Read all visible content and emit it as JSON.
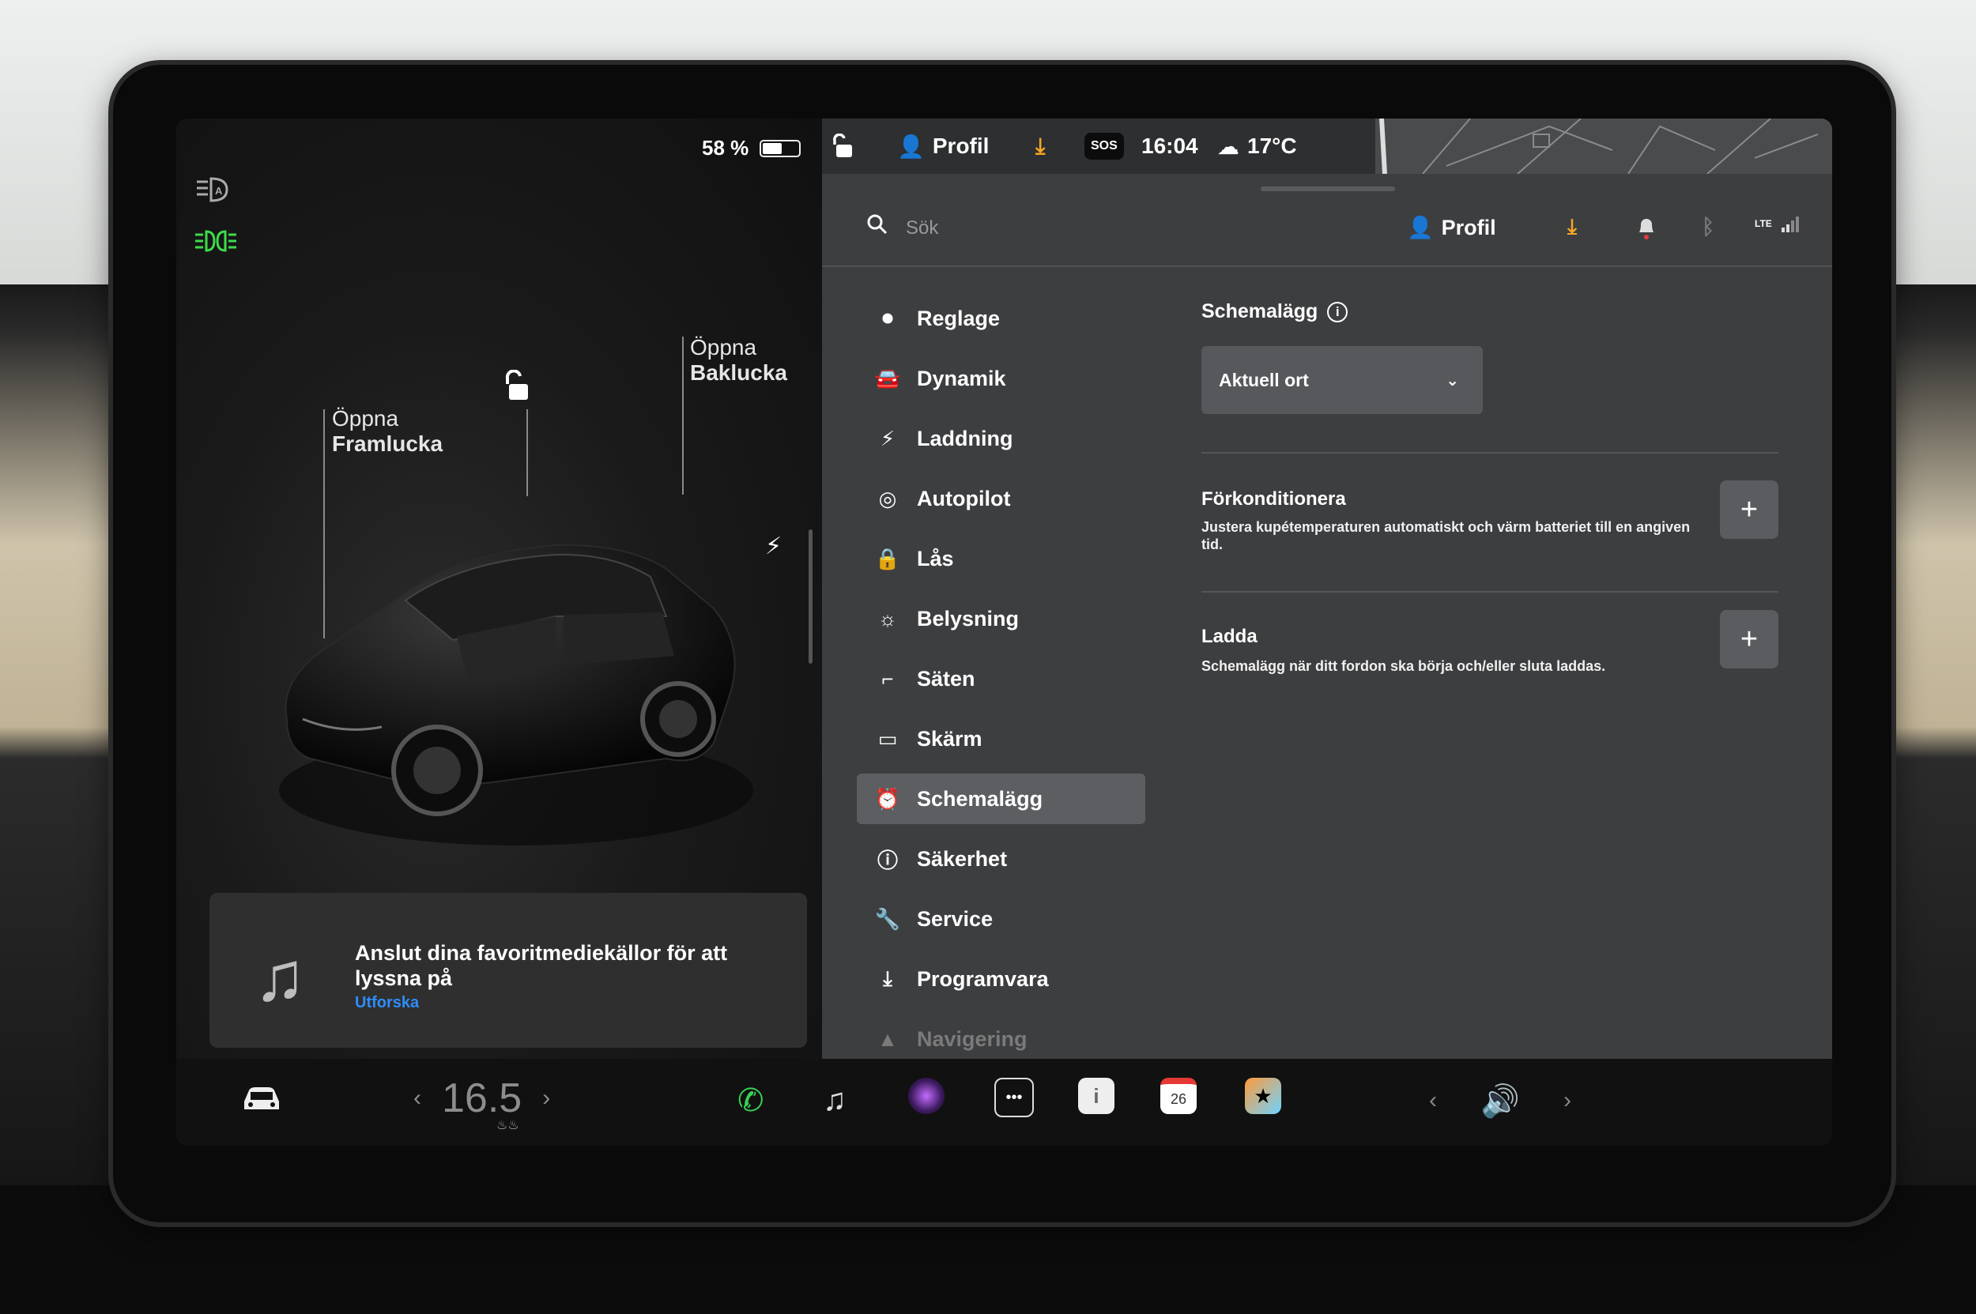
{
  "status": {
    "battery_percent_label": "58 %",
    "battery_level": 0.58,
    "profile_label": "Profil",
    "sos_label": "SOS",
    "time": "16:04",
    "temperature": "17°C"
  },
  "car_panel": {
    "front_trunk_line1": "Öppna",
    "front_trunk_line2": "Framlucka",
    "rear_trunk_line1": "Öppna",
    "rear_trunk_line2": "Baklucka"
  },
  "media": {
    "message": "Anslut dina favoritmediekällor för att lyssna på",
    "link": "Utforska"
  },
  "header": {
    "search_placeholder": "Sök",
    "profile_label": "Profil",
    "network_label": "LTE"
  },
  "menu": {
    "items": [
      {
        "label": "Reglage",
        "icon": "toggle-icon"
      },
      {
        "label": "Dynamik",
        "icon": "car-front-icon"
      },
      {
        "label": "Laddning",
        "icon": "bolt-icon"
      },
      {
        "label": "Autopilot",
        "icon": "steering-wheel-icon"
      },
      {
        "label": "Lås",
        "icon": "lock-icon"
      },
      {
        "label": "Belysning",
        "icon": "sun-icon"
      },
      {
        "label": "Säten",
        "icon": "seat-icon"
      },
      {
        "label": "Skärm",
        "icon": "display-icon"
      },
      {
        "label": "Schemalägg",
        "icon": "alarm-clock-icon"
      },
      {
        "label": "Säkerhet",
        "icon": "alert-circle-icon"
      },
      {
        "label": "Service",
        "icon": "wrench-icon"
      },
      {
        "label": "Programvara",
        "icon": "download-icon"
      },
      {
        "label": "Navigering",
        "icon": "navigation-icon"
      }
    ],
    "active": "Schemalägg"
  },
  "schedule": {
    "title": "Schemalägg",
    "location_value": "Aktuell ort",
    "precondition_title": "Förkonditionera",
    "precondition_desc": "Justera kupétemperaturen automatiskt och värm batteriet till en angiven tid.",
    "charge_title": "Ladda",
    "charge_desc": "Schemalägg när ditt fordon ska börja och/eller sluta laddas."
  },
  "dock": {
    "temperature_value": "16.5",
    "calendar_day": "26"
  },
  "colors": {
    "accent_orange": "#f5a623",
    "link_blue": "#2f8dff",
    "headlight_green": "#3ddc4b",
    "phone_green": "#39d353"
  }
}
